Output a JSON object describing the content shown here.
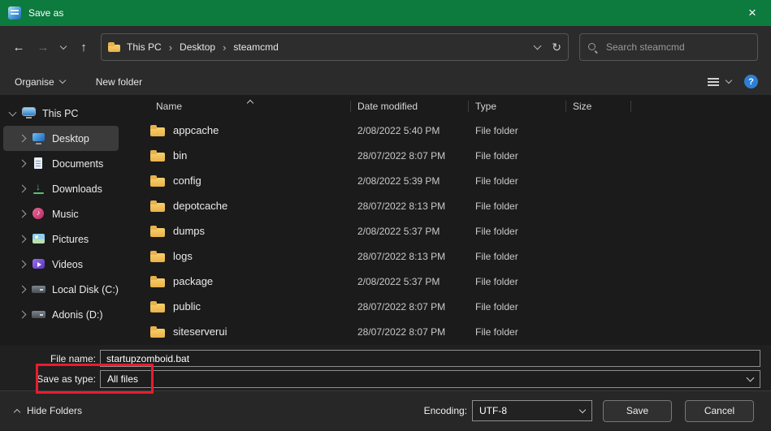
{
  "window": {
    "title": "Save as"
  },
  "icons": {
    "back": "←",
    "forward": "→",
    "up": "↑",
    "close": "×",
    "refresh": "↻",
    "crumb_separator": "›",
    "help": "?"
  },
  "nav": {
    "breadcrumb": {
      "root": "This PC",
      "second": "Desktop",
      "third": "steamcmd"
    },
    "search_placeholder": "Search steamcmd"
  },
  "toolbar": {
    "organise_label": "Organise",
    "new_folder_label": "New folder"
  },
  "sidebar": {
    "items": [
      {
        "label": "This PC",
        "expanded": true
      },
      {
        "label": "Desktop",
        "selected": true
      },
      {
        "label": "Documents"
      },
      {
        "label": "Downloads"
      },
      {
        "label": "Music"
      },
      {
        "label": "Pictures"
      },
      {
        "label": "Videos"
      },
      {
        "label": "Local Disk (C:)"
      },
      {
        "label": "Adonis (D:)"
      }
    ]
  },
  "file_list": {
    "columns": {
      "name": "Name",
      "date": "Date modified",
      "type": "Type",
      "size": "Size"
    },
    "sort": {
      "column": "Name",
      "direction": "ascending"
    },
    "rows": [
      {
        "name": "appcache",
        "date": "2/08/2022 5:40 PM",
        "type": "File folder",
        "size": ""
      },
      {
        "name": "bin",
        "date": "28/07/2022 8:07 PM",
        "type": "File folder",
        "size": ""
      },
      {
        "name": "config",
        "date": "2/08/2022 5:39 PM",
        "type": "File folder",
        "size": ""
      },
      {
        "name": "depotcache",
        "date": "28/07/2022 8:13 PM",
        "type": "File folder",
        "size": ""
      },
      {
        "name": "dumps",
        "date": "2/08/2022 5:37 PM",
        "type": "File folder",
        "size": ""
      },
      {
        "name": "logs",
        "date": "28/07/2022 8:13 PM",
        "type": "File folder",
        "size": ""
      },
      {
        "name": "package",
        "date": "2/08/2022 5:37 PM",
        "type": "File folder",
        "size": ""
      },
      {
        "name": "public",
        "date": "28/07/2022 8:07 PM",
        "type": "File folder",
        "size": ""
      },
      {
        "name": "siteserverui",
        "date": "28/07/2022 8:07 PM",
        "type": "File folder",
        "size": ""
      }
    ]
  },
  "fields": {
    "file_name_label": "File name:",
    "file_name_value": "startupzomboid.bat",
    "save_as_type_label": "Save as type:",
    "save_as_type_value": "All files"
  },
  "footer": {
    "hide_folders_label": "Hide Folders",
    "encoding_label": "Encoding:",
    "encoding_value": "UTF-8",
    "save_label": "Save",
    "cancel_label": "Cancel"
  },
  "colors": {
    "titlebar_green": "#0d7a3e",
    "annotation_red": "#ea1b2d",
    "help_blue": "#2d7fd6"
  }
}
